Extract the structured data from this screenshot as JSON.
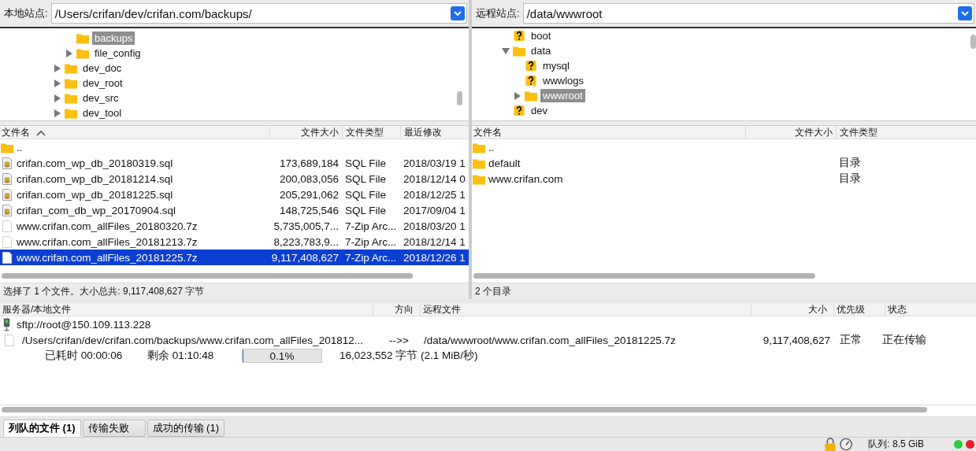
{
  "local_site": {
    "label": "本地站点:",
    "path": "/Users/crifan/dev/crifan.com/backups/",
    "tree": [
      {
        "children": [
          {
            "label": "backups",
            "kind": "folder",
            "selected": true
          },
          {
            "label": "file_config",
            "kind": "folder",
            "expanded": false,
            "selected": false
          }
        ]
      },
      {
        "label": "dev_doc",
        "kind": "folder",
        "expanded": false,
        "selected": false
      },
      {
        "label": "dev_root",
        "kind": "folder",
        "expanded": false,
        "selected": false
      },
      {
        "label": "dev_src",
        "kind": "folder",
        "expanded": false,
        "selected": false
      },
      {
        "label": "dev_tool",
        "kind": "folder",
        "expanded": false,
        "selected": false
      }
    ],
    "columns": [
      {
        "label": "文件名",
        "sorted": true
      },
      {
        "label": "文件大小",
        "sorted": false
      },
      {
        "label": "文件类型",
        "sorted": false
      },
      {
        "label": "最近修改",
        "sorted": false
      }
    ],
    "rows": [
      {
        "kind": "folder",
        "name": "..",
        "size": "",
        "type": "",
        "modified": "",
        "selected": false
      },
      {
        "kind": "sql",
        "name": "crifan.com_wp_db_20180319.sql",
        "size": "173,689,184",
        "type": "SQL File",
        "modified": "2018/03/19 1",
        "selected": false
      },
      {
        "kind": "sql",
        "name": "crifan.com_wp_db_20181214.sql",
        "size": "200,083,056",
        "type": "SQL File",
        "modified": "2018/12/14 0",
        "selected": false
      },
      {
        "kind": "sql",
        "name": "crifan.com_wp_db_20181225.sql",
        "size": "205,291,062",
        "type": "SQL File",
        "modified": "2018/12/25 1",
        "selected": false
      },
      {
        "kind": "sql",
        "name": "crifan_com_db_wp_20170904.sql",
        "size": "148,725,546",
        "type": "SQL File",
        "modified": "2017/09/04 1",
        "selected": false
      },
      {
        "kind": "file",
        "name": "www.crifan.com_allFiles_20180320.7z",
        "size": "5,735,005,7...",
        "type": "7-Zip Arc...",
        "modified": "2018/03/20 1",
        "selected": false
      },
      {
        "kind": "file",
        "name": "www.crifan.com_allFiles_20181213.7z",
        "size": "8,223,783,9...",
        "type": "7-Zip Arc...",
        "modified": "2018/12/14 1",
        "selected": false
      },
      {
        "kind": "file",
        "name": "www.crifan.com_allFiles_20181225.7z",
        "size": "9,117,408,627",
        "type": "7-Zip Arc...",
        "modified": "2018/12/26 1",
        "selected": true
      }
    ],
    "status": "选择了 1 个文件。大小总共: 9,117,408,627 字节"
  },
  "remote_site": {
    "label": "远程站点:",
    "path": "/data/wwwroot",
    "tree": [
      {
        "label": "boot",
        "kind": "unknown",
        "selected": false
      },
      {
        "label": "data",
        "kind": "folder",
        "expanded": true,
        "selected": false,
        "children": [
          {
            "label": "mysql",
            "kind": "unknown",
            "selected": false
          },
          {
            "label": "wwwlogs",
            "kind": "unknown",
            "selected": false
          },
          {
            "label": "wwwroot",
            "kind": "folder",
            "expanded": false,
            "selected": true
          }
        ]
      },
      {
        "label": "dev",
        "kind": "unknown",
        "selected": false
      }
    ],
    "columns": [
      {
        "label": "文件名",
        "sorted": false
      },
      {
        "label": "文件大小",
        "sorted": false
      },
      {
        "label": "文件类型",
        "sorted": false
      }
    ],
    "rows": [
      {
        "kind": "folder",
        "name": "..",
        "size": "",
        "type": "",
        "selected": false
      },
      {
        "kind": "folder",
        "name": "default",
        "size": "",
        "type": "目录",
        "selected": false
      },
      {
        "kind": "folder",
        "name": "www.crifan.com",
        "size": "",
        "type": "目录",
        "selected": false
      }
    ],
    "status": "2 个目录"
  },
  "queue": {
    "columns": [
      "服务器/本地文件",
      "方向",
      "远程文件",
      "大小",
      "优先级",
      "状态"
    ],
    "server": "sftp://root@150.109.113.228",
    "item": {
      "local": "/Users/crifan/dev/crifan.com/backups/www.crifan.com_allFiles_201812...",
      "direction": "-->>",
      "remote": "/data/wwwroot/www.crifan.com_allFiles_20181225.7z",
      "size": "9,117,408,627",
      "priority": "正常",
      "status": "正在传输"
    },
    "progress": {
      "elapsed": "已耗时 00:00:06",
      "remaining": "剩余 01:10:48",
      "level": 0.001,
      "percent": "0.1%",
      "transferred": "16,023,552 字节 (2.1 MiB/秒)"
    },
    "tabs": [
      {
        "label": "列队的文件 (1)",
        "selected": true
      },
      {
        "label": "传输失败",
        "selected": false
      },
      {
        "label": "成功的传输 (1)",
        "selected": false
      }
    ]
  },
  "status_bar": {
    "queue": "队列: 8.5 GiB",
    "lights": [
      {
        "color": "#2ecc40"
      },
      {
        "color": "#e8202a"
      }
    ]
  }
}
